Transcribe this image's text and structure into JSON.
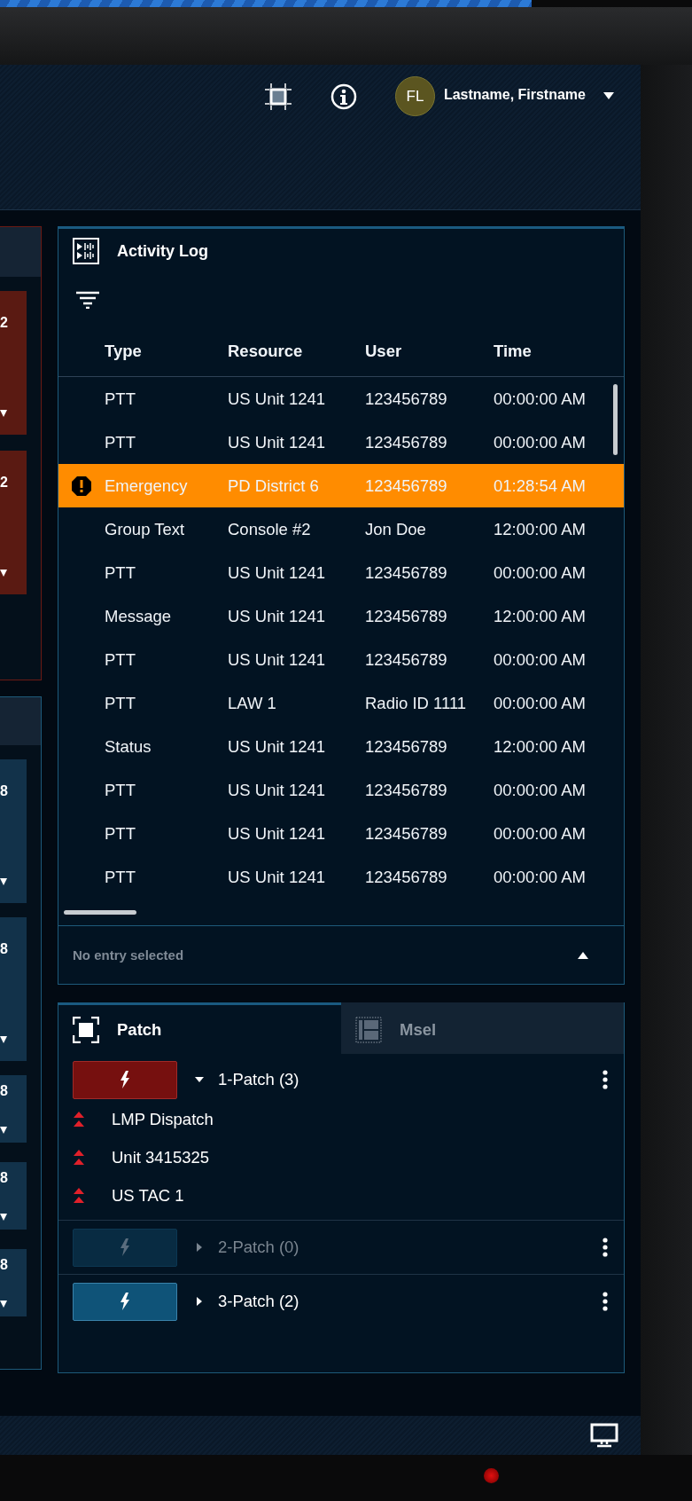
{
  "header": {
    "initials": "FL",
    "user_name": "Lastname, Firstname"
  },
  "left_panels": [
    {
      "kind": "alert",
      "cards": [
        {
          "text": "2",
          "kind": "tall"
        },
        {
          "text": "2",
          "kind": "tall"
        }
      ]
    },
    {
      "kind": "normal",
      "cards": [
        {
          "text": "8",
          "kind": "tall"
        },
        {
          "text": "8",
          "kind": "tall"
        },
        {
          "text": "8",
          "kind": "short"
        },
        {
          "text": "8",
          "kind": "short"
        },
        {
          "text": "8",
          "kind": "short"
        }
      ]
    }
  ],
  "activity_log": {
    "title": "Activity Log",
    "columns": [
      "Type",
      "Resource",
      "User",
      "Time"
    ],
    "rows": [
      {
        "type": "PTT",
        "resource": "US Unit 1241",
        "user": "123456789",
        "time": "00:00:00 AM",
        "alert": false
      },
      {
        "type": "PTT",
        "resource": "US Unit 1241",
        "user": "123456789",
        "time": "00:00:00 AM",
        "alert": false
      },
      {
        "type": "Emergency",
        "resource": "PD District 6",
        "user": "123456789",
        "time": "01:28:54 AM",
        "alert": true
      },
      {
        "type": "Group Text",
        "resource": "Console #2",
        "user": "Jon Doe",
        "time": "12:00:00 AM",
        "alert": false
      },
      {
        "type": "PTT",
        "resource": "US Unit 1241",
        "user": "123456789",
        "time": "00:00:00 AM",
        "alert": false
      },
      {
        "type": "Message",
        "resource": "US Unit 1241",
        "user": "123456789",
        "time": "12:00:00 AM",
        "alert": false
      },
      {
        "type": "PTT",
        "resource": "US Unit 1241",
        "user": "123456789",
        "time": "00:00:00 AM",
        "alert": false
      },
      {
        "type": "PTT",
        "resource": "LAW 1",
        "user": "Radio ID 1111",
        "time": "00:00:00 AM",
        "alert": false
      },
      {
        "type": "Status",
        "resource": "US Unit 1241",
        "user": "123456789",
        "time": "12:00:00 AM",
        "alert": false
      },
      {
        "type": "PTT",
        "resource": "US Unit 1241",
        "user": "123456789",
        "time": "00:00:00 AM",
        "alert": false
      },
      {
        "type": "PTT",
        "resource": "US Unit 1241",
        "user": "123456789",
        "time": "00:00:00 AM",
        "alert": false
      },
      {
        "type": "PTT",
        "resource": "US Unit 1241",
        "user": "123456789",
        "time": "00:00:00 AM",
        "alert": false
      }
    ],
    "footer": "No entry selected"
  },
  "patch_panel": {
    "tabs": [
      {
        "label": "Patch",
        "kind": "patch",
        "selected": true
      },
      {
        "label": "Msel",
        "kind": "msel",
        "selected": false
      }
    ],
    "patches": [
      {
        "name": "1-Patch (3)",
        "kind": "active",
        "expanded": true,
        "members": [
          "LMP Dispatch",
          "Unit 3415325",
          "US TAC 1"
        ]
      },
      {
        "name": "2-Patch (0)",
        "kind": "disabled",
        "expanded": false
      },
      {
        "name": "3-Patch (2)",
        "kind": "idle",
        "expanded": false
      }
    ]
  }
}
